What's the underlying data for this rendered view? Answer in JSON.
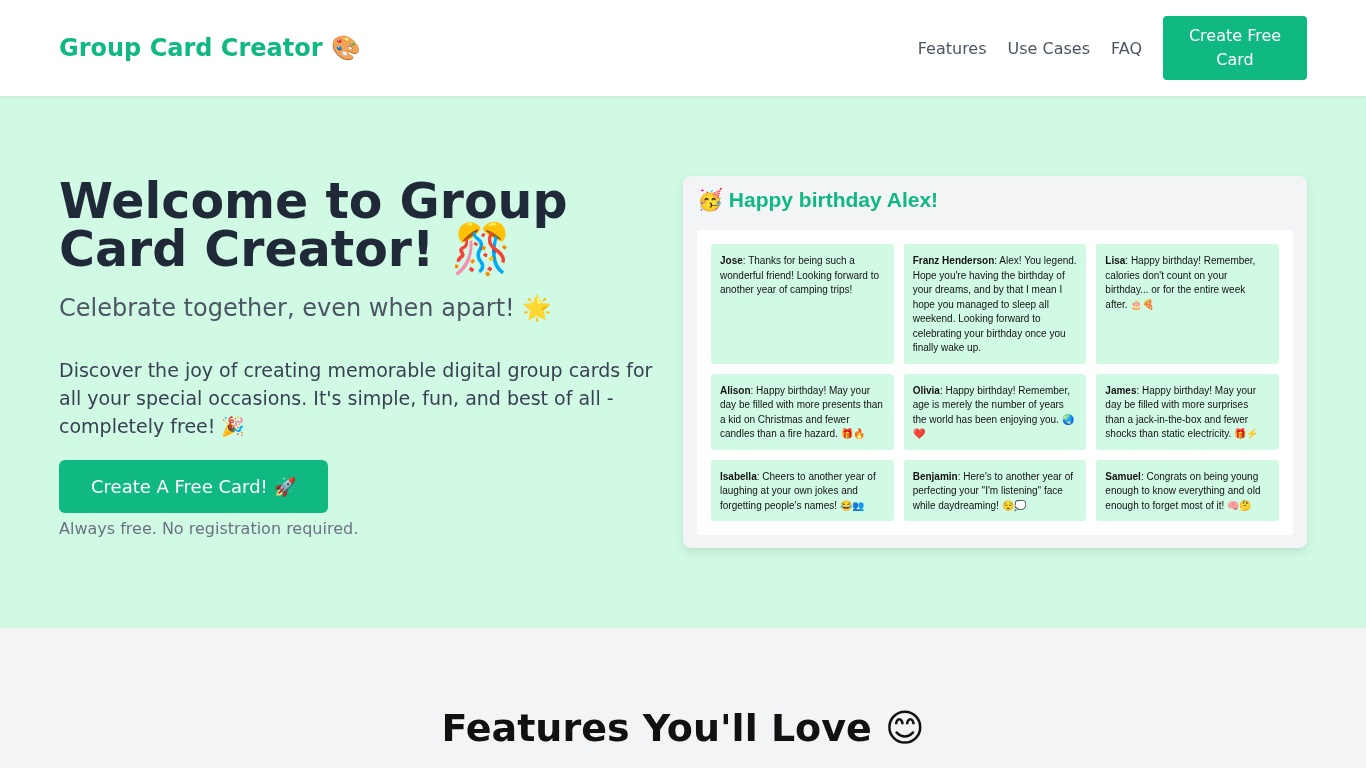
{
  "header": {
    "logo": "Group Card Creator 🎨",
    "nav": [
      {
        "label": "Features"
      },
      {
        "label": "Use Cases"
      },
      {
        "label": "FAQ"
      }
    ],
    "cta": "Create Free Card"
  },
  "hero": {
    "title": "Welcome to Group Card Creator! 🎊",
    "subtitle": "Celebrate together, even when apart! 🌟",
    "description": "Discover the joy of creating memorable digital group cards for all your special occasions. It's simple, fun, and best of all - completely free! 🎉",
    "button": "Create A Free Card! 🚀",
    "note": "Always free. No registration required."
  },
  "preview": {
    "title": "🥳 Happy birthday Alex!",
    "messages": [
      {
        "text": "**Jose**: Thanks for being such a wonderful friend! Looking forward to another year of camping trips!"
      },
      {
        "text": "**Franz Henderson**: Alex! You legend. Hope you're having the birthday of your dreams, and by that I mean I hope you managed to sleep all weekend. Looking forward to celebrating your birthday once you finally wake up."
      },
      {
        "text": "**Lisa**: Happy birthday! Remember, calories don't count on your birthday... or for the entire week after. 🎂🍕"
      },
      {
        "text": "**Alison**: Happy birthday! May your day be filled with more presents than a kid on Christmas and fewer candles than a fire hazard. 🎁🔥"
      },
      {
        "text": "**Olivia**: Happy birthday! Remember, age is merely the number of years the world has been enjoying you. 🌏❤️"
      },
      {
        "text": "**James**: Happy birthday! May your day be filled with more surprises than a jack-in-the-box and fewer shocks than static electricity. 🎁⚡"
      },
      {
        "text": "**Isabella**: Cheers to another year of laughing at your own jokes and forgetting people's names! 😂👥"
      },
      {
        "text": "**Benjamin**: Here's to another year of perfecting your \"I'm listening\" face while daydreaming! 😌💭"
      },
      {
        "text": "**Samuel**: Congrats on being young enough to know everything and old enough to forget most of it! 🧠🤔"
      }
    ]
  },
  "features": {
    "heading": "Features You'll Love 😊"
  }
}
